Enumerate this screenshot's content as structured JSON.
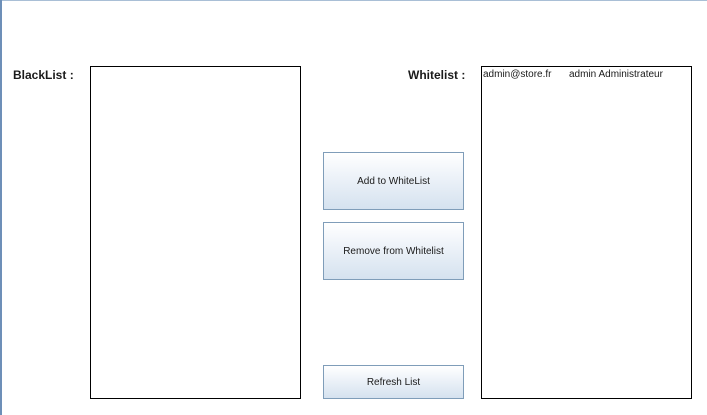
{
  "blacklist": {
    "label": "BlackList :",
    "items": []
  },
  "whitelist": {
    "label": "Whitelist :",
    "items": [
      {
        "email": "admin@store.fr",
        "name": "admin Administrateur"
      }
    ]
  },
  "buttons": {
    "add": "Add to WhiteList",
    "remove": "Remove from Whitelist",
    "refresh": "Refresh List"
  }
}
